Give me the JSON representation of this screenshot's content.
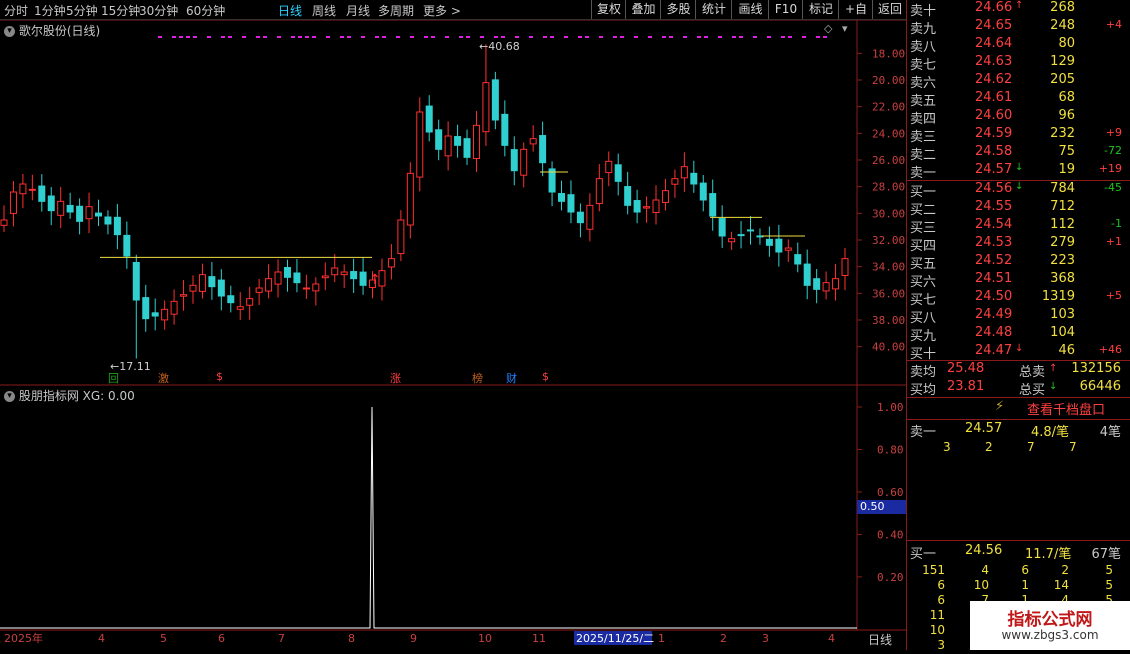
{
  "toolbar": {
    "periods": [
      "分时",
      "1分钟",
      "5分钟",
      "15分钟",
      "30分钟",
      "60分钟",
      "日线",
      "周线",
      "月线",
      "多周期",
      "更多 >"
    ],
    "active_period": "日线",
    "buttons": [
      "复权",
      "叠加",
      "多股",
      "统计",
      "画线",
      "F10",
      "标记",
      "+自选",
      "返回"
    ]
  },
  "main_pane": {
    "title": "歌尔股份(日线)",
    "high_label": "40.68",
    "low_label": "17.11",
    "y_ticks": [
      "40.00",
      "38.00",
      "36.00",
      "34.00",
      "32.00",
      "30.00",
      "28.00",
      "26.00",
      "24.00",
      "22.00",
      "20.00",
      "18.00"
    ],
    "event_markers": [
      "回",
      "激",
      "$",
      "涨",
      "榜",
      "财",
      "$"
    ]
  },
  "sub_pane": {
    "title": "股朋指标网 XG: 0.00",
    "y_ticks": [
      "1.00",
      "0.80",
      "0.60",
      "0.40",
      "0.20"
    ],
    "highlight_value": "0.50"
  },
  "x_axis": {
    "labels": [
      "2025年",
      "4",
      "5",
      "6",
      "7",
      "8",
      "9",
      "10",
      "11",
      "2025/11/25/二",
      "1",
      "2",
      "3",
      "4"
    ],
    "period_label": "日线"
  },
  "order_book": {
    "asks": [
      {
        "label": "卖十",
        "price": "24.66",
        "vol": "268",
        "arrow": "↑",
        "chg": ""
      },
      {
        "label": "卖九",
        "price": "24.65",
        "vol": "248",
        "arrow": "",
        "chg": "+4"
      },
      {
        "label": "卖八",
        "price": "24.64",
        "vol": "80",
        "arrow": "",
        "chg": ""
      },
      {
        "label": "卖七",
        "price": "24.63",
        "vol": "129",
        "arrow": "",
        "chg": ""
      },
      {
        "label": "卖六",
        "price": "24.62",
        "vol": "205",
        "arrow": "",
        "chg": ""
      },
      {
        "label": "卖五",
        "price": "24.61",
        "vol": "68",
        "arrow": "",
        "chg": ""
      },
      {
        "label": "卖四",
        "price": "24.60",
        "vol": "96",
        "arrow": "",
        "chg": ""
      },
      {
        "label": "卖三",
        "price": "24.59",
        "vol": "232",
        "arrow": "",
        "chg": "+9"
      },
      {
        "label": "卖二",
        "price": "24.58",
        "vol": "75",
        "arrow": "",
        "chg": "-72"
      },
      {
        "label": "卖一",
        "price": "24.57",
        "vol": "19",
        "arrow": "↓",
        "chg": "+19"
      }
    ],
    "bids": [
      {
        "label": "买一",
        "price": "24.56",
        "vol": "784",
        "arrow": "↓",
        "chg": "-45"
      },
      {
        "label": "买二",
        "price": "24.55",
        "vol": "712",
        "arrow": "",
        "chg": ""
      },
      {
        "label": "买三",
        "price": "24.54",
        "vol": "112",
        "arrow": "",
        "chg": "-1"
      },
      {
        "label": "买四",
        "price": "24.53",
        "vol": "279",
        "arrow": "",
        "chg": "+1"
      },
      {
        "label": "买五",
        "price": "24.52",
        "vol": "223",
        "arrow": "",
        "chg": ""
      },
      {
        "label": "买六",
        "price": "24.51",
        "vol": "368",
        "arrow": "",
        "chg": ""
      },
      {
        "label": "买七",
        "price": "24.50",
        "vol": "1319",
        "arrow": "",
        "chg": "+5"
      },
      {
        "label": "买八",
        "price": "24.49",
        "vol": "103",
        "arrow": "",
        "chg": ""
      },
      {
        "label": "买九",
        "price": "24.48",
        "vol": "104",
        "arrow": "",
        "chg": ""
      },
      {
        "label": "买十",
        "price": "24.47",
        "vol": "46",
        "arrow": "↓",
        "chg": "+46"
      }
    ],
    "avg_sell_label": "卖均",
    "avg_sell": "25.48",
    "total_sell_label": "总卖",
    "total_sell": "132156",
    "avg_buy_label": "买均",
    "avg_buy": "23.81",
    "total_buy_label": "总买",
    "total_buy": "66446",
    "thousand_btn": "查看千档盘口",
    "sell1": {
      "label": "卖一",
      "price": "24.57",
      "per": "4.8/笔",
      "count": "4笔",
      "detail": [
        "3",
        "2",
        "7",
        "7"
      ]
    },
    "buy1": {
      "label": "买一",
      "price": "24.56",
      "per": "11.7/笔",
      "count": "67笔",
      "detail_rows": [
        [
          "151",
          "4",
          "6",
          "2",
          "5"
        ],
        [
          "6",
          "10",
          "1",
          "14",
          "5"
        ],
        [
          "6",
          "7",
          "1",
          "4",
          "5"
        ],
        [
          "11",
          "",
          "",
          "",
          ""
        ],
        [
          "10",
          "",
          "",
          "",
          ""
        ],
        [
          "3",
          "",
          "",
          "",
          ""
        ]
      ]
    }
  },
  "watermark": {
    "line1": "指标公式网",
    "line2": "www.zbgs3.com"
  },
  "chart_data": {
    "type": "candlestick",
    "title": "歌尔股份(日线)",
    "ylim": [
      17,
      41
    ],
    "y_ticks": [
      18,
      20,
      22,
      24,
      26,
      28,
      30,
      32,
      34,
      36,
      38,
      40
    ],
    "x_month_labels": [
      "2025年",
      "4",
      "5",
      "6",
      "7",
      "8",
      "9",
      "10",
      "11",
      "1",
      "2",
      "3",
      "4"
    ],
    "close_series": [
      27.5,
      29.6,
      30.2,
      29.8,
      28.9,
      28.2,
      28.9,
      28.1,
      27.4,
      28.5,
      27.8,
      27.2,
      26.4,
      24.8,
      21.5,
      20.1,
      20.3,
      20.8,
      21.4,
      21.9,
      22.6,
      23.4,
      22.5,
      21.8,
      21.3,
      21.0,
      21.6,
      22.4,
      23.1,
      23.6,
      23.2,
      22.8,
      22.4,
      22.7,
      23.3,
      23.9,
      23.6,
      23.1,
      22.6,
      23.0,
      23.7,
      24.6,
      27.5,
      31.0,
      35.6,
      34.1,
      32.8,
      33.8,
      33.1,
      32.2,
      34.6,
      37.8,
      35.0,
      33.1,
      31.2,
      32.8,
      33.6,
      31.8,
      29.6,
      28.9,
      28.1,
      27.3,
      28.6,
      30.6,
      31.9,
      30.4,
      28.6,
      28.1,
      28.5,
      29.0,
      29.7,
      30.6,
      31.5,
      30.2,
      29.0,
      27.8,
      26.3,
      26.1,
      26.4,
      26.7,
      26.3,
      25.6,
      25.1,
      25.4,
      24.2,
      22.6,
      22.3,
      22.8,
      23.1,
      24.6
    ],
    "high": 40.68,
    "low": 17.11,
    "support_lines": [
      [
        24.6,
        "2025-04",
        "2025-08"
      ],
      [
        31.1,
        "2025-10",
        "2025-11"
      ],
      [
        27.6,
        "2026-01",
        "2026-02"
      ],
      [
        26.3,
        "2026-03",
        "2026-03"
      ]
    ],
    "indicator": {
      "name": "XG",
      "values_nonzero_at": "2025-08 end",
      "peak": 1.0,
      "ylim": [
        0,
        1.05
      ],
      "y_ticks": [
        0.2,
        0.4,
        0.6,
        0.8,
        1.0
      ]
    }
  }
}
